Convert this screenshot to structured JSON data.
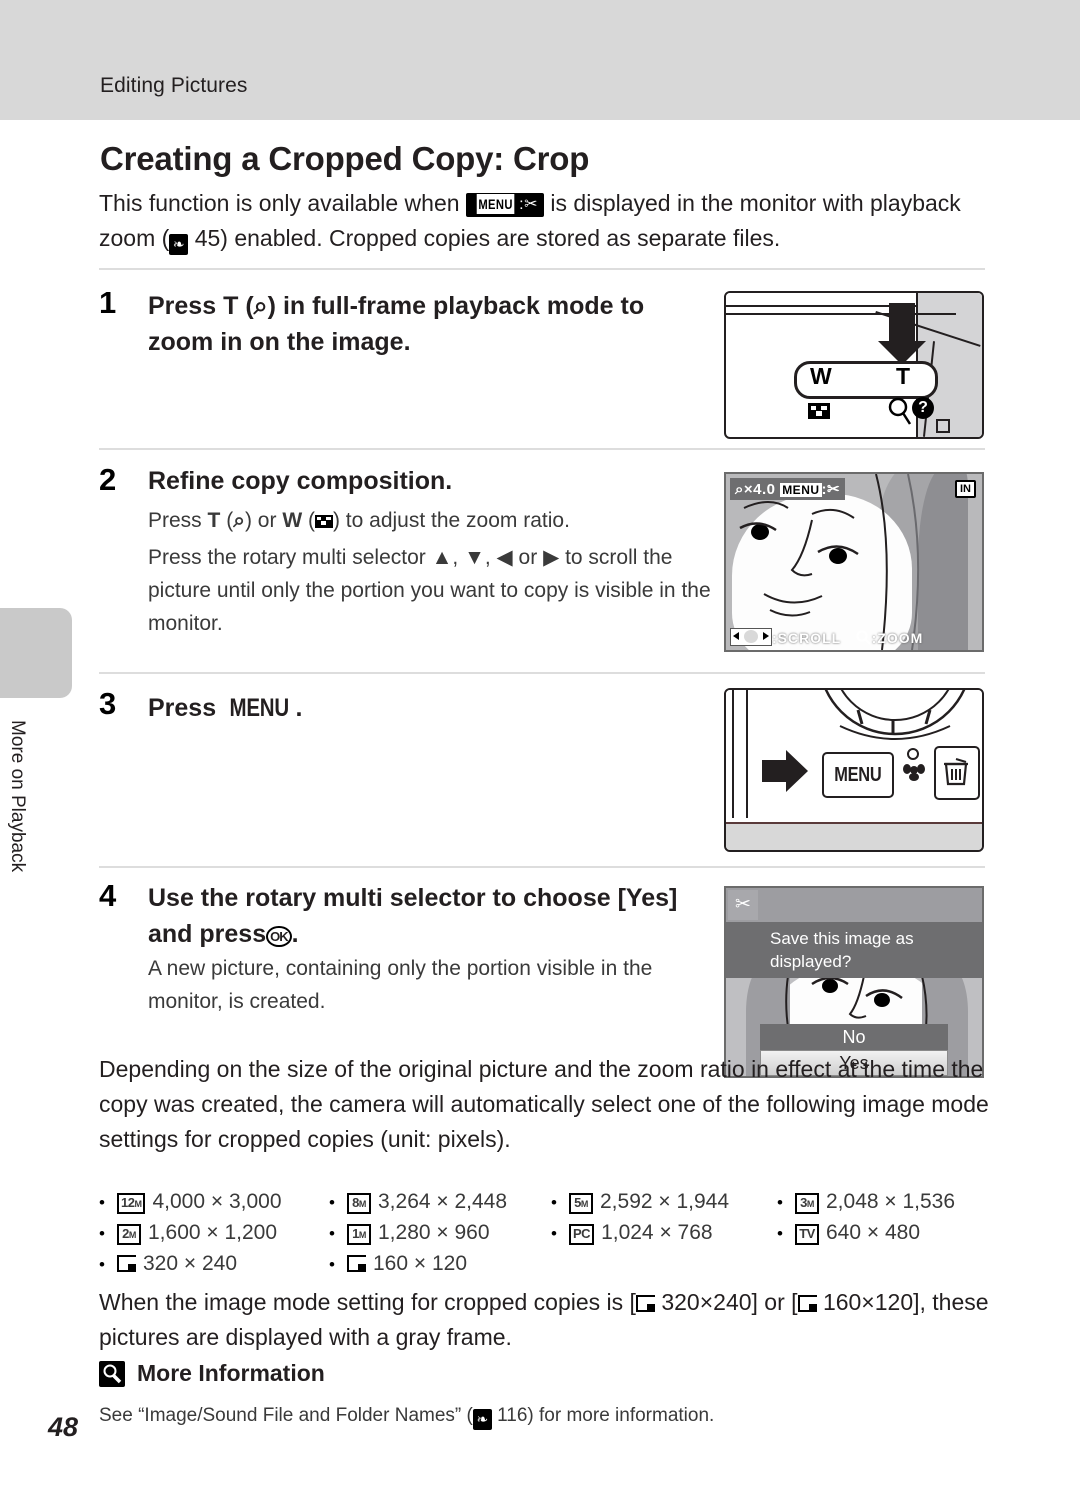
{
  "header": {
    "section_title": "Editing Pictures"
  },
  "side_tab": {
    "label": "More on Playback"
  },
  "page": {
    "heading": "Creating a Cropped Copy: Crop",
    "number": "48"
  },
  "intro": {
    "part1": "This function is only available when",
    "badge_menu": "MENU",
    "badge_sep": ":",
    "badge_scissors": "✂",
    "part2": "is displayed in the monitor with playback zoom (",
    "ref_icon": "❧",
    "ref_page": "45",
    "part3": ") enabled. Cropped copies are stored as separate files."
  },
  "steps": [
    {
      "number": "1",
      "title_pre": "Press",
      "title_key": "T",
      "title_paren_open": "(",
      "title_icon": "⌕",
      "title_paren_close": ")",
      "title_post": "in full-frame playback mode to zoom in on the image.",
      "illustration": {
        "name": "camera-top-zoom-control",
        "label_w": "W",
        "label_t": "T",
        "thumb_icon": "thumbnail-grid-icon",
        "help_icon": "?"
      }
    },
    {
      "number": "2",
      "title": "Refine copy composition.",
      "body1_pre": "Press",
      "body1_key_t": "T",
      "body1_icon_t": "⌕",
      "body1_or": "or",
      "body1_key_w": "W",
      "body1_icon_w": "thumbnail-grid-icon",
      "body1_post": "to adjust the zoom ratio.",
      "body2_pre": "Press the rotary multi selector",
      "body2_up": "▲",
      "body2_down": "▼",
      "body2_left": "◀",
      "body2_right": "▶",
      "body2_or": "or",
      "body2_post": "to scroll the picture until only the portion you want to copy is visible in the monitor.",
      "monitor": {
        "name": "playback-zoom-monitor",
        "zoom_ratio": "⌕×4.0",
        "menu_label": "MENU",
        "menu_sep": ":",
        "scissors": "✂",
        "memory_badge": "IN",
        "hint_scroll": ":SCROLL",
        "hint_zoom": ":ZOOM"
      }
    },
    {
      "number": "3",
      "title_pre": "Press",
      "title_key": "MENU",
      "title_post": ".",
      "illustration": {
        "name": "camera-back-menu-button",
        "menu_button": "MENU",
        "macro_icon": "macro-flower-icon",
        "delete_icon": "trash-icon"
      }
    },
    {
      "number": "4",
      "title_pre": "Use the rotary multi selector to choose [Yes] and press",
      "title_key": "OK",
      "title_post": ".",
      "body": "A new picture, containing only the portion visible in the monitor, is created.",
      "dialog": {
        "name": "save-confirmation-dialog",
        "crop_icon": "✂",
        "message": "Save this image as displayed?",
        "option_no": "No",
        "option_yes": "Yes"
      }
    }
  ],
  "body_paragraph": "Depending on the size of the original picture and the zoom ratio in effect at the time the copy was created, the camera will automatically select one of the following image mode settings for cropped copies (unit: pixels).",
  "image_modes": [
    [
      {
        "icon": "12",
        "icon_sub": "M",
        "icon_type": "label",
        "value": "4,000 × 3,000"
      },
      {
        "icon": "8",
        "icon_sub": "M",
        "icon_type": "label",
        "value": "3,264 × 2,448"
      },
      {
        "icon": "5",
        "icon_sub": "M",
        "icon_type": "label",
        "value": "2,592 × 1,944"
      },
      {
        "icon": "3",
        "icon_sub": "M",
        "icon_type": "label",
        "value": "2,048 × 1,536"
      }
    ],
    [
      {
        "icon": "2",
        "icon_sub": "M",
        "icon_type": "label",
        "value": "1,600 × 1,200"
      },
      {
        "icon": "1",
        "icon_sub": "M",
        "icon_type": "label",
        "value": "1,280 × 960"
      },
      {
        "icon": "PC",
        "icon_sub": "",
        "icon_type": "label",
        "value": "1,024 × 768"
      },
      {
        "icon": "TV",
        "icon_sub": "",
        "icon_type": "label",
        "value": "640 × 480"
      }
    ],
    [
      {
        "icon": "",
        "icon_sub": "",
        "icon_type": "small-picture",
        "value": "320 × 240"
      },
      {
        "icon": "",
        "icon_sub": "",
        "icon_type": "small-picture",
        "value": "160 × 120"
      }
    ]
  ],
  "closing_paragraph": {
    "part1": "When the image mode setting for cropped copies is [",
    "size1": "320×240",
    "part2": "] or [",
    "size2": "160×120",
    "part3": "], these pictures are displayed with a gray frame."
  },
  "more_information": {
    "heading": "More Information",
    "note_part1": "See “Image/Sound File and Folder Names” (",
    "note_ref_icon": "❧",
    "note_page": "116",
    "note_part2": ") for more information."
  },
  "colors": {
    "header_band": "#d8d8d8",
    "side_tab": "#c9c9c9",
    "rule": "#dddddd",
    "osd_gray": "#6e6e70",
    "monitor_bg": "#b9b9bb",
    "ink": "#231f20"
  }
}
